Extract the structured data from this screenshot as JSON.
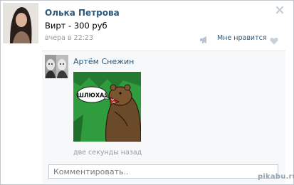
{
  "post": {
    "author_name": "Олька Петрова",
    "text": "Вирт - 300 руб",
    "time": "вчера в 22:23",
    "like_label": "Мне нравится",
    "like_count": ""
  },
  "comment": {
    "author_name": "Артём Снежин",
    "time": "две секунды назад",
    "image_text": "ШЛЮХА!"
  },
  "comment_input": {
    "placeholder": "Комментировать.."
  },
  "watermark": "pikabu.ru",
  "colors": {
    "link": "#2b587a",
    "muted": "#999999",
    "image_background": "#2f9c3e"
  },
  "icons": {
    "close": "close-icon",
    "share": "megaphone-icon",
    "like": "heart-icon"
  }
}
